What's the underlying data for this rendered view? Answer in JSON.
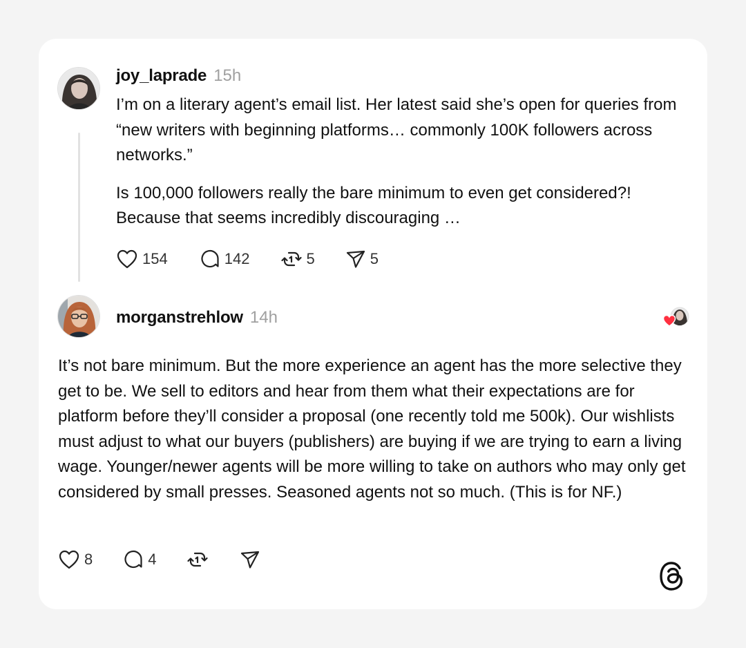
{
  "post1": {
    "username": "joy_laprade",
    "timestamp": "15h",
    "paragraphs": [
      "I’m on a literary agent’s email list. Her latest said she’s open for queries from “new writers with beginning platforms… commonly 100K followers across networks.”",
      "Is 100,000 followers really the bare minimum to even get considered?! Because that seems incredibly discouraging …"
    ],
    "actions": {
      "likes": "154",
      "replies": "142",
      "reposts": "5",
      "shares": "5"
    }
  },
  "reply": {
    "username": "morganstrehlow",
    "timestamp": "14h",
    "text": "It’s not bare minimum. But the more experience an agent has the more selective they get to be. We sell to editors and hear from them what their expectations are for platform before they’ll consider a proposal (one recently told me 500k). Our wishlists must adjust to what our buyers (publishers) are buying if we are trying to earn a living wage. Younger/newer agents will be more willing to take on authors who may only get considered by small presses. Seasoned agents not so much. (This is for NF.)",
    "actions": {
      "likes": "8",
      "replies": "4"
    }
  },
  "icons": {
    "heart": "heart-icon",
    "reply": "reply-icon",
    "repost": "repost-icon",
    "share": "share-icon",
    "liked_badge": "liked-heart-icon",
    "brand": "threads-logo-icon"
  },
  "colors": {
    "background": "#f4f4f4",
    "card": "#ffffff",
    "text": "#111111",
    "muted": "#a0a0a0",
    "like_red": "#ff3040"
  }
}
